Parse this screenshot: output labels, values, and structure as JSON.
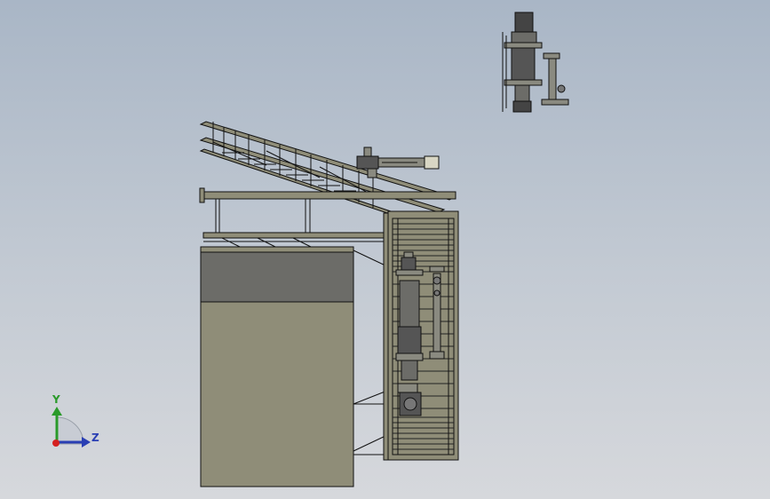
{
  "viewport": {
    "background_top": "#a9b6c6",
    "background_bottom": "#d6d8dc"
  },
  "triad": {
    "y_label": "Y",
    "z_label": "Z",
    "y_color": "#2a9a2a",
    "z_color": "#2a3fb4",
    "origin_color": "#d42020"
  },
  "model": {
    "name": "equipment-assembly",
    "structure_color": "#8f8d78",
    "panel_dark_color": "#6c6c68",
    "outline_color": "#111111",
    "parts": [
      "stair-frame",
      "tank-body",
      "ladder-cage",
      "pump-assembly",
      "detached-pump-assembly"
    ]
  }
}
